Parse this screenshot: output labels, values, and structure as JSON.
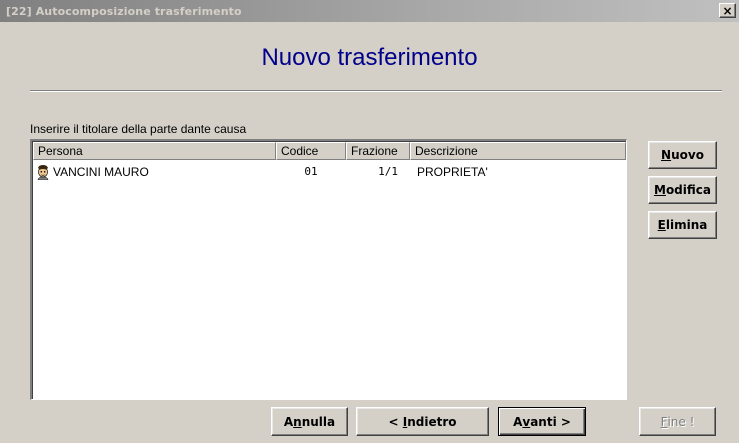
{
  "window": {
    "title": "[22] Autocomposizione trasferimento",
    "close_label": "×"
  },
  "heading": "Nuovo trasferimento",
  "instruction": "Inserire il titolare della parte dante causa",
  "list": {
    "columns": [
      "Persona",
      "Codice",
      "Frazione",
      "Descrizione"
    ],
    "rows": [
      {
        "icon": "person-icon",
        "persona": "VANCINI MAURO",
        "codice": "01",
        "frazione": "1/1",
        "descrizione": "PROPRIETA'"
      }
    ]
  },
  "side_buttons": {
    "nuovo": {
      "mnemonic": "N",
      "rest": "uovo"
    },
    "modifica": {
      "mnemonic": "M",
      "rest": "odifica"
    },
    "elimina": {
      "mnemonic": "E",
      "rest": "limina"
    }
  },
  "nav_buttons": {
    "annulla": {
      "pre": "A",
      "mnemonic": "n",
      "rest": "nulla"
    },
    "indietro": {
      "pre": "< ",
      "mnemonic": "I",
      "rest": "ndietro"
    },
    "avanti": {
      "pre": "A",
      "mnemonic": "v",
      "rest": "anti >"
    },
    "fine": {
      "mnemonic": "F",
      "rest": "ine !"
    }
  },
  "colors": {
    "heading": "#00008b",
    "face": "#d4d0c8",
    "titlebar_start": "#808080"
  }
}
